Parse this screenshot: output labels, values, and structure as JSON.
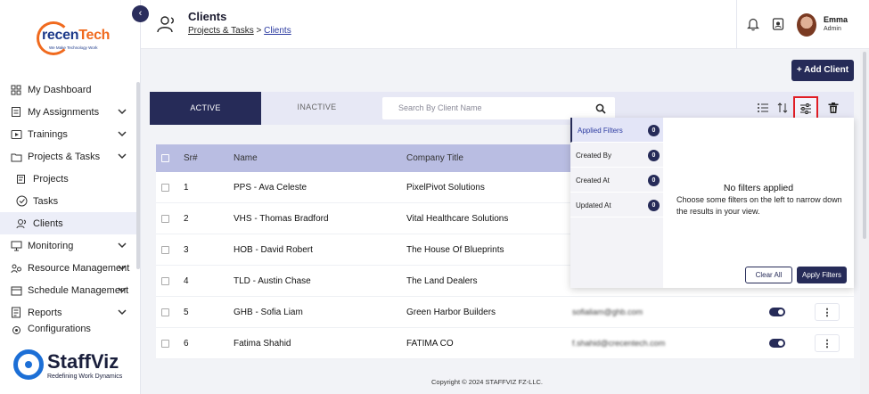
{
  "brand": {
    "logo_text_a": "recen",
    "logo_text_b": "Tech",
    "logo_tagline": "We Make Technology Work",
    "product_name": "StaffViz",
    "product_tagline": "Redefining Work Dynamics"
  },
  "sidebar": {
    "items": [
      {
        "label": "My Dashboard",
        "icon": "dashboard-icon",
        "chevron": false
      },
      {
        "label": "My Assignments",
        "icon": "assignments-icon",
        "chevron": true
      },
      {
        "label": "Trainings",
        "icon": "trainings-icon",
        "chevron": true
      },
      {
        "label": "Projects & Tasks",
        "icon": "projects-tasks-icon",
        "chevron": true
      },
      {
        "label": "Projects",
        "icon": "projects-icon",
        "sub": true
      },
      {
        "label": "Tasks",
        "icon": "tasks-icon",
        "sub": true
      },
      {
        "label": "Clients",
        "icon": "clients-icon",
        "sub": true,
        "active": true
      },
      {
        "label": "Monitoring",
        "icon": "monitoring-icon",
        "chevron": true
      },
      {
        "label": "Resource Management",
        "icon": "resource-icon",
        "chevron": true
      },
      {
        "label": "Schedule Management",
        "icon": "schedule-icon",
        "chevron": true
      },
      {
        "label": "Reports",
        "icon": "reports-icon",
        "chevron": true
      },
      {
        "label": "Configurations",
        "icon": "configurations-icon",
        "chevron": true
      }
    ]
  },
  "header": {
    "title": "Clients",
    "breadcrumb_parent": "Projects & Tasks",
    "breadcrumb_sep": ">",
    "breadcrumb_current": "Clients",
    "user_name": "Emma",
    "user_role": "Admin"
  },
  "toolbar": {
    "add_label": "+ Add Client",
    "tab_active": "ACTIVE",
    "tab_inactive": "INACTIVE",
    "search_placeholder": "Search By Client Name"
  },
  "table": {
    "headers": {
      "sr": "Sr#",
      "name": "Name",
      "company": "Company Title"
    },
    "rows": [
      {
        "sr": "1",
        "name": "PPS - Ava Celeste",
        "company": "PixelPivot Solutions",
        "email": "",
        "active": true
      },
      {
        "sr": "2",
        "name": "VHS - Thomas Bradford",
        "company": "Vital Healthcare Solutions",
        "email": "",
        "active": true
      },
      {
        "sr": "3",
        "name": "HOB - David Robert",
        "company": "The House Of Blueprints",
        "email": "",
        "active": true
      },
      {
        "sr": "4",
        "name": "TLD - Austin Chase",
        "company": "The Land Dealers",
        "email": "",
        "active": true
      },
      {
        "sr": "5",
        "name": "GHB - Sofia Liam",
        "company": "Green Harbor Builders",
        "email": "sofialiam@ghb.com",
        "active": true
      },
      {
        "sr": "6",
        "name": "Fatima Shahid",
        "company": "FATIMA CO",
        "email": "f.shahid@crecentech.com",
        "active": true
      }
    ]
  },
  "filters": {
    "items": [
      {
        "label": "Applied Filters",
        "count": "0"
      },
      {
        "label": "Created By",
        "count": "0"
      },
      {
        "label": "Created At",
        "count": "0"
      },
      {
        "label": "Updated At",
        "count": "0"
      }
    ],
    "empty_title": "No filters applied",
    "empty_text": "Choose some filters on the left to narrow down the results in your view.",
    "clear_label": "Clear All",
    "apply_label": "Apply Filters"
  },
  "footer": {
    "copyright": "Copyright © 2024 STAFFVIZ FZ-LLC."
  },
  "colors": {
    "primary": "#262b58",
    "accent_red": "#e11d24",
    "brand_orange": "#f06a1e",
    "brand_blue": "#1c6fd6"
  }
}
